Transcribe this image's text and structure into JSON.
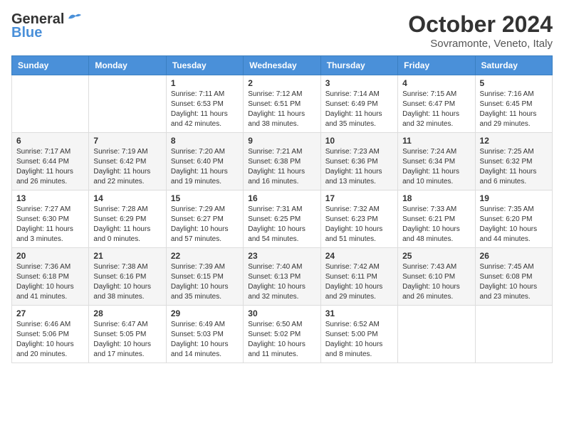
{
  "header": {
    "logo_general": "General",
    "logo_blue": "Blue",
    "month_title": "October 2024",
    "subtitle": "Sovramonte, Veneto, Italy"
  },
  "weekdays": [
    "Sunday",
    "Monday",
    "Tuesday",
    "Wednesday",
    "Thursday",
    "Friday",
    "Saturday"
  ],
  "rows": [
    [
      {
        "day": "",
        "sunrise": "",
        "sunset": "",
        "daylight": ""
      },
      {
        "day": "",
        "sunrise": "",
        "sunset": "",
        "daylight": ""
      },
      {
        "day": "1",
        "sunrise": "Sunrise: 7:11 AM",
        "sunset": "Sunset: 6:53 PM",
        "daylight": "Daylight: 11 hours and 42 minutes."
      },
      {
        "day": "2",
        "sunrise": "Sunrise: 7:12 AM",
        "sunset": "Sunset: 6:51 PM",
        "daylight": "Daylight: 11 hours and 38 minutes."
      },
      {
        "day": "3",
        "sunrise": "Sunrise: 7:14 AM",
        "sunset": "Sunset: 6:49 PM",
        "daylight": "Daylight: 11 hours and 35 minutes."
      },
      {
        "day": "4",
        "sunrise": "Sunrise: 7:15 AM",
        "sunset": "Sunset: 6:47 PM",
        "daylight": "Daylight: 11 hours and 32 minutes."
      },
      {
        "day": "5",
        "sunrise": "Sunrise: 7:16 AM",
        "sunset": "Sunset: 6:45 PM",
        "daylight": "Daylight: 11 hours and 29 minutes."
      }
    ],
    [
      {
        "day": "6",
        "sunrise": "Sunrise: 7:17 AM",
        "sunset": "Sunset: 6:44 PM",
        "daylight": "Daylight: 11 hours and 26 minutes."
      },
      {
        "day": "7",
        "sunrise": "Sunrise: 7:19 AM",
        "sunset": "Sunset: 6:42 PM",
        "daylight": "Daylight: 11 hours and 22 minutes."
      },
      {
        "day": "8",
        "sunrise": "Sunrise: 7:20 AM",
        "sunset": "Sunset: 6:40 PM",
        "daylight": "Daylight: 11 hours and 19 minutes."
      },
      {
        "day": "9",
        "sunrise": "Sunrise: 7:21 AM",
        "sunset": "Sunset: 6:38 PM",
        "daylight": "Daylight: 11 hours and 16 minutes."
      },
      {
        "day": "10",
        "sunrise": "Sunrise: 7:23 AM",
        "sunset": "Sunset: 6:36 PM",
        "daylight": "Daylight: 11 hours and 13 minutes."
      },
      {
        "day": "11",
        "sunrise": "Sunrise: 7:24 AM",
        "sunset": "Sunset: 6:34 PM",
        "daylight": "Daylight: 11 hours and 10 minutes."
      },
      {
        "day": "12",
        "sunrise": "Sunrise: 7:25 AM",
        "sunset": "Sunset: 6:32 PM",
        "daylight": "Daylight: 11 hours and 6 minutes."
      }
    ],
    [
      {
        "day": "13",
        "sunrise": "Sunrise: 7:27 AM",
        "sunset": "Sunset: 6:30 PM",
        "daylight": "Daylight: 11 hours and 3 minutes."
      },
      {
        "day": "14",
        "sunrise": "Sunrise: 7:28 AM",
        "sunset": "Sunset: 6:29 PM",
        "daylight": "Daylight: 11 hours and 0 minutes."
      },
      {
        "day": "15",
        "sunrise": "Sunrise: 7:29 AM",
        "sunset": "Sunset: 6:27 PM",
        "daylight": "Daylight: 10 hours and 57 minutes."
      },
      {
        "day": "16",
        "sunrise": "Sunrise: 7:31 AM",
        "sunset": "Sunset: 6:25 PM",
        "daylight": "Daylight: 10 hours and 54 minutes."
      },
      {
        "day": "17",
        "sunrise": "Sunrise: 7:32 AM",
        "sunset": "Sunset: 6:23 PM",
        "daylight": "Daylight: 10 hours and 51 minutes."
      },
      {
        "day": "18",
        "sunrise": "Sunrise: 7:33 AM",
        "sunset": "Sunset: 6:21 PM",
        "daylight": "Daylight: 10 hours and 48 minutes."
      },
      {
        "day": "19",
        "sunrise": "Sunrise: 7:35 AM",
        "sunset": "Sunset: 6:20 PM",
        "daylight": "Daylight: 10 hours and 44 minutes."
      }
    ],
    [
      {
        "day": "20",
        "sunrise": "Sunrise: 7:36 AM",
        "sunset": "Sunset: 6:18 PM",
        "daylight": "Daylight: 10 hours and 41 minutes."
      },
      {
        "day": "21",
        "sunrise": "Sunrise: 7:38 AM",
        "sunset": "Sunset: 6:16 PM",
        "daylight": "Daylight: 10 hours and 38 minutes."
      },
      {
        "day": "22",
        "sunrise": "Sunrise: 7:39 AM",
        "sunset": "Sunset: 6:15 PM",
        "daylight": "Daylight: 10 hours and 35 minutes."
      },
      {
        "day": "23",
        "sunrise": "Sunrise: 7:40 AM",
        "sunset": "Sunset: 6:13 PM",
        "daylight": "Daylight: 10 hours and 32 minutes."
      },
      {
        "day": "24",
        "sunrise": "Sunrise: 7:42 AM",
        "sunset": "Sunset: 6:11 PM",
        "daylight": "Daylight: 10 hours and 29 minutes."
      },
      {
        "day": "25",
        "sunrise": "Sunrise: 7:43 AM",
        "sunset": "Sunset: 6:10 PM",
        "daylight": "Daylight: 10 hours and 26 minutes."
      },
      {
        "day": "26",
        "sunrise": "Sunrise: 7:45 AM",
        "sunset": "Sunset: 6:08 PM",
        "daylight": "Daylight: 10 hours and 23 minutes."
      }
    ],
    [
      {
        "day": "27",
        "sunrise": "Sunrise: 6:46 AM",
        "sunset": "Sunset: 5:06 PM",
        "daylight": "Daylight: 10 hours and 20 minutes."
      },
      {
        "day": "28",
        "sunrise": "Sunrise: 6:47 AM",
        "sunset": "Sunset: 5:05 PM",
        "daylight": "Daylight: 10 hours and 17 minutes."
      },
      {
        "day": "29",
        "sunrise": "Sunrise: 6:49 AM",
        "sunset": "Sunset: 5:03 PM",
        "daylight": "Daylight: 10 hours and 14 minutes."
      },
      {
        "day": "30",
        "sunrise": "Sunrise: 6:50 AM",
        "sunset": "Sunset: 5:02 PM",
        "daylight": "Daylight: 10 hours and 11 minutes."
      },
      {
        "day": "31",
        "sunrise": "Sunrise: 6:52 AM",
        "sunset": "Sunset: 5:00 PM",
        "daylight": "Daylight: 10 hours and 8 minutes."
      },
      {
        "day": "",
        "sunrise": "",
        "sunset": "",
        "daylight": ""
      },
      {
        "day": "",
        "sunrise": "",
        "sunset": "",
        "daylight": ""
      }
    ]
  ]
}
